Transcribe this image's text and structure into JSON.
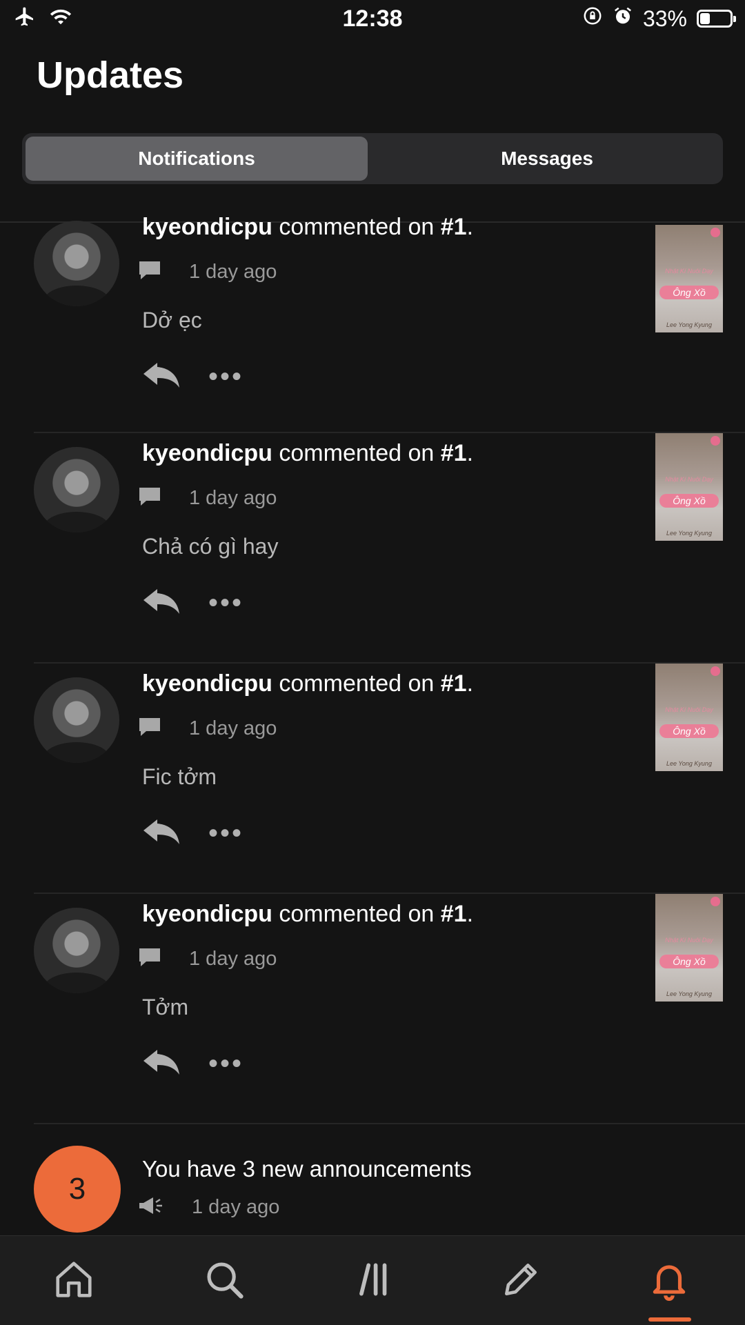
{
  "status_bar": {
    "time": "12:38",
    "battery_percent_text": "33%",
    "battery_level": 0.33,
    "icons": [
      "airplane-icon",
      "wifi-icon",
      "orientation-lock-icon",
      "alarm-icon",
      "battery-icon"
    ]
  },
  "page": {
    "title": "Updates"
  },
  "segments": {
    "notifications": "Notifications",
    "messages": "Messages",
    "active": "notifications"
  },
  "notifications": [
    {
      "user": "kyeondicpu",
      "action": "commented on",
      "target": "#1",
      "period": ".",
      "time": "1 day ago",
      "comment": "Dở ẹc"
    },
    {
      "user": "kyeondicpu",
      "action": "commented on",
      "target": "#1",
      "period": ".",
      "time": "1 day ago",
      "comment": "Chả có gì hay"
    },
    {
      "user": "kyeondicpu",
      "action": "commented on",
      "target": "#1",
      "period": ".",
      "time": "1 day ago",
      "comment": "Fic tởm"
    },
    {
      "user": "kyeondicpu",
      "action": "commented on",
      "target": "#1",
      "period": ".",
      "time": "1 day ago",
      "comment": "Tởm"
    }
  ],
  "story_cover": {
    "title": "Ông Xồ",
    "subtitle": "Nhật Kí Nuôi Dạy",
    "author": "Lee Yong Kyung"
  },
  "announcement": {
    "count": "3",
    "text": "You have 3 new announcements",
    "time": "1 day ago"
  },
  "tabbar": {
    "items": [
      "home-icon",
      "search-icon",
      "library-icon",
      "write-icon",
      "bell-icon"
    ],
    "active": "bell-icon"
  },
  "colors": {
    "accent": "#ec6b3a",
    "background": "#141414",
    "segment_active": "#636366"
  }
}
